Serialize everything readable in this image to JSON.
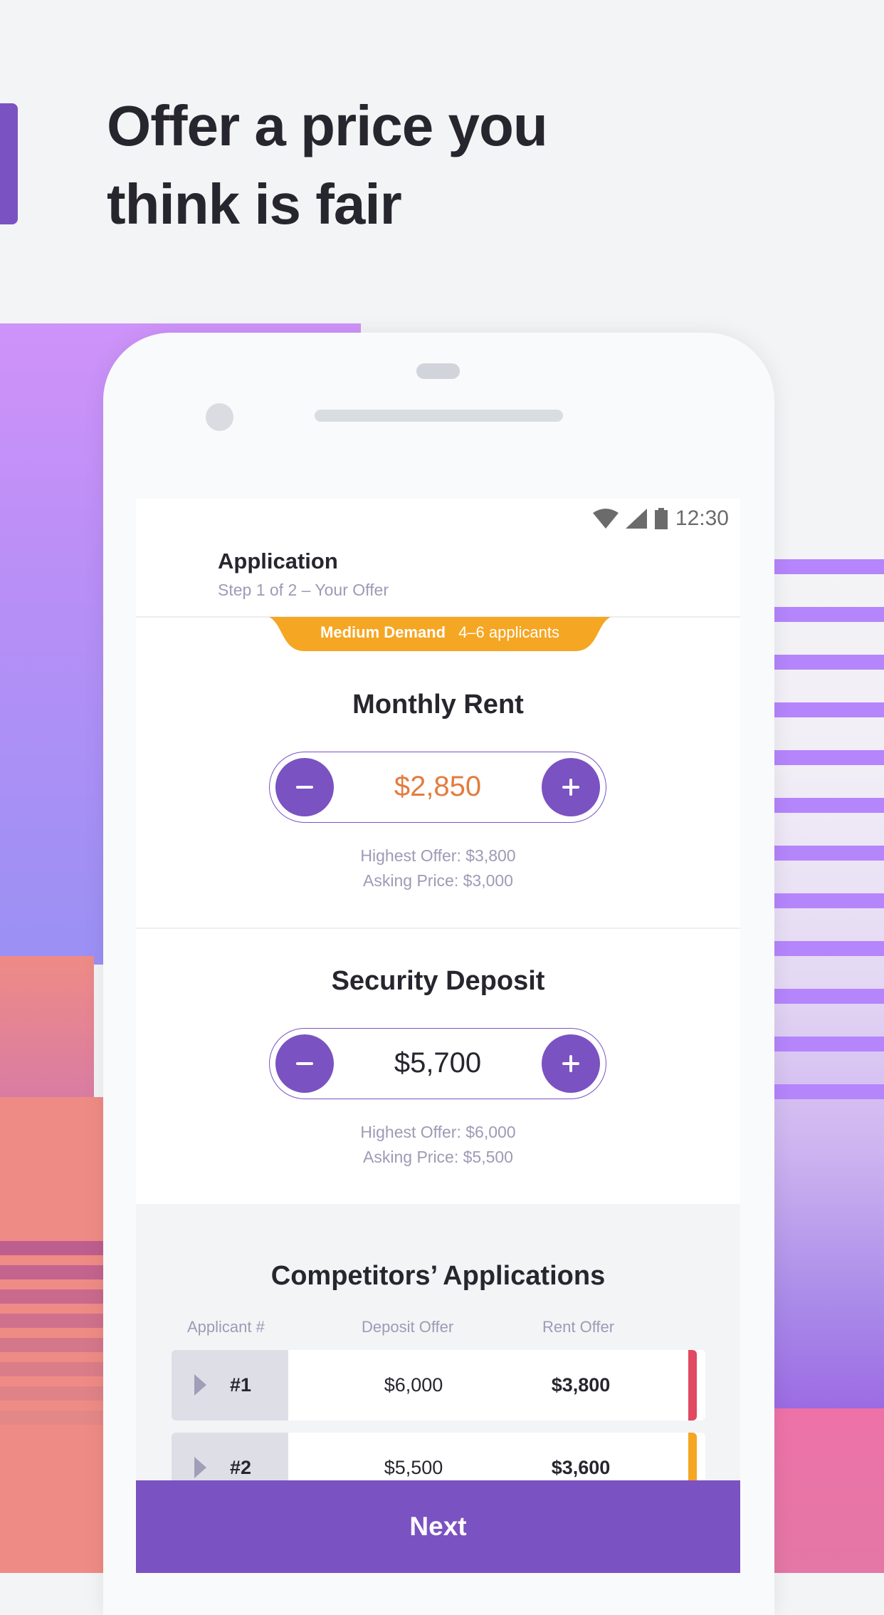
{
  "headline": {
    "line1": "Offer a price you",
    "line2": "think is fair"
  },
  "status_bar": {
    "time": "12:30",
    "icons": [
      "wifi-icon",
      "cellular-signal-icon",
      "battery-icon"
    ]
  },
  "header": {
    "title": "Application",
    "subtitle": "Step 1 of 2 – Your Offer"
  },
  "demand_badge": {
    "level": "Medium Demand",
    "applicants": "4–6 applicants",
    "color": "#F5A623"
  },
  "monthly_rent": {
    "title": "Monthly Rent",
    "value": "$2,850",
    "value_color": "#E27D3F",
    "highest_offer": "Highest Offer: $3,800",
    "asking_price": "Asking Price: $3,000",
    "decrement_icon": "minus-icon",
    "increment_icon": "plus-icon"
  },
  "security_deposit": {
    "title": "Security Deposit",
    "value": "$5,700",
    "value_color": "#27262E",
    "highest_offer": "Highest Offer: $6,000",
    "asking_price": "Asking Price: $5,500",
    "decrement_icon": "minus-icon",
    "increment_icon": "plus-icon"
  },
  "competitors": {
    "title": "Competitors’ Applications",
    "columns": [
      "Applicant #",
      "Deposit Offer",
      "Rent Offer"
    ],
    "rows": [
      {
        "applicant": "#1",
        "deposit": "$6,000",
        "rent": "$3,800",
        "indicator_color": "#E04A63"
      },
      {
        "applicant": "#2",
        "deposit": "$5,500",
        "rent": "$3,600",
        "indicator_color": "#F5A623"
      }
    ]
  },
  "footer": {
    "next_label": "Next"
  },
  "colors": {
    "brand_purple": "#7B52C1",
    "text_dark": "#27262E",
    "text_muted": "#9D9BB5"
  }
}
